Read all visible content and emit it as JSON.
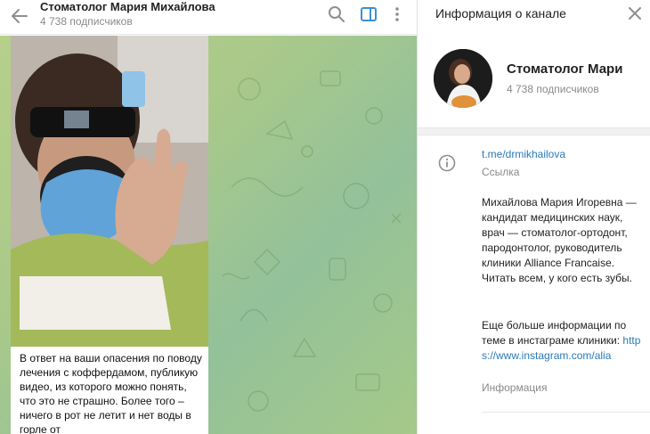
{
  "chat": {
    "title": "Стоматолог Мария Михайлова",
    "subscribers": "4 738 подписчиков",
    "message_text": "В ответ на ваши опасения по поводу лечения с коффердамом, публикую видео, из которого можно понять, что это не страшно. Более того – ничего в рот не летит и нет воды в горле от"
  },
  "info_panel": {
    "title": "Информация о канале",
    "channel_name": "Стоматолог Мари",
    "subscribers": "4 738 подписчиков",
    "link": "t.me/drmikhailova",
    "link_caption": "Ссылка",
    "description": "Михайлова Мария Игоревна — кандидат медицинских наук, врач — стоматолог-ортодонт, пародонтолог, руководитель клиники Alliance Francaise. Читать всем, у кого есть зубы.",
    "description_more": "Еще больше информации по теме в инстаграме клиники: ",
    "instagram_link": "https://www.instagram.com/alia",
    "description_caption": "Информация"
  },
  "icons": {
    "back": "arrow-left-icon",
    "search": "search-icon",
    "side_panel": "side-panel-icon",
    "more": "more-vertical-icon",
    "close": "close-icon",
    "info": "info-icon"
  },
  "colors": {
    "accent": "#2b7ab8",
    "chat_bg": "#a9c98a"
  }
}
